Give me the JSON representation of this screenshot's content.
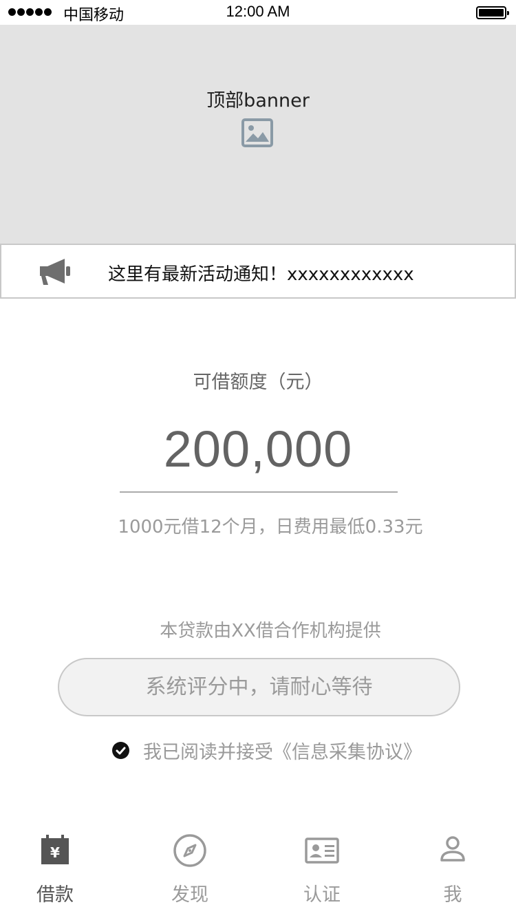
{
  "status_bar": {
    "carrier": "中国移动",
    "time": "12:00 AM"
  },
  "banner": {
    "title": "顶部banner",
    "icon": "image-placeholder-icon"
  },
  "notice": {
    "icon": "megaphone-icon",
    "text": "这里有最新活动通知！xxxxxxxxxxxx"
  },
  "loan": {
    "limit_label": "可借额度（元）",
    "amount": "200,000",
    "fee_note": "1000元借12个月，日费用最低0.33元",
    "provider_note": "本贷款由XX借合作机构提供",
    "status_button": "系统评分中，请耐心等待",
    "agreement_checked": true,
    "agreement_text": "我已阅读并接受《信息采集协议》"
  },
  "tabbar": {
    "active_tab": "借款",
    "items": [
      {
        "label": "借款",
        "icon": "yen-calendar-icon"
      },
      {
        "label": "发现",
        "icon": "compass-icon"
      },
      {
        "label": "认证",
        "icon": "id-card-icon"
      },
      {
        "label": "我",
        "icon": "user-icon"
      }
    ]
  },
  "colors": {
    "banner_bg": "#e3e3e3",
    "text_muted": "#9a9a9a",
    "amount_text": "#636363",
    "button_bg": "#f2f2f2"
  }
}
